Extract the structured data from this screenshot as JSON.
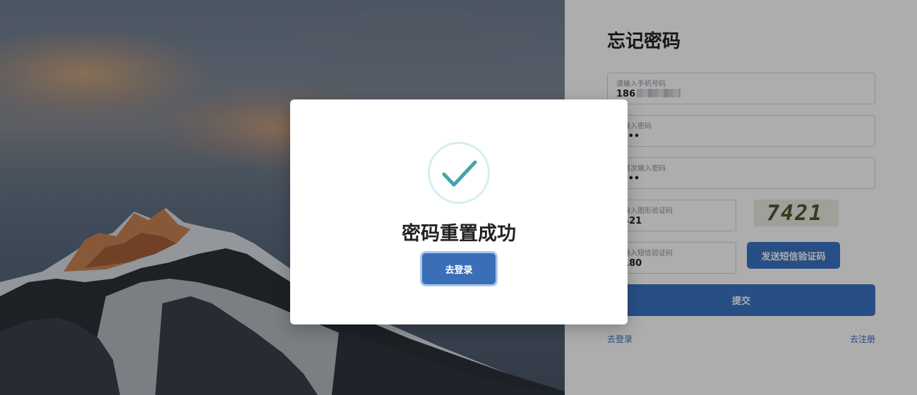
{
  "form": {
    "title": "忘记密码",
    "phone": {
      "placeholder": "请输入手机号码",
      "value": "186"
    },
    "password": {
      "placeholder": "请输入密码",
      "value": "••••"
    },
    "confirm_password": {
      "placeholder": "请再次输入密码",
      "value": "••••"
    },
    "image_code": {
      "placeholder": "请输入图形验证码",
      "value": "7421"
    },
    "captcha_text": "7421",
    "sms_code": {
      "placeholder": "请输入短信验证码",
      "value": "1180"
    },
    "send_sms_label": "发送短信验证码",
    "submit_label": "提交",
    "login_link": "去登录",
    "register_link": "去注册"
  },
  "modal": {
    "title": "密码重置成功",
    "button_label": "去登录",
    "icon": "check-icon"
  },
  "colors": {
    "primary": "#3a75c4",
    "check": "#3fa6a8"
  }
}
